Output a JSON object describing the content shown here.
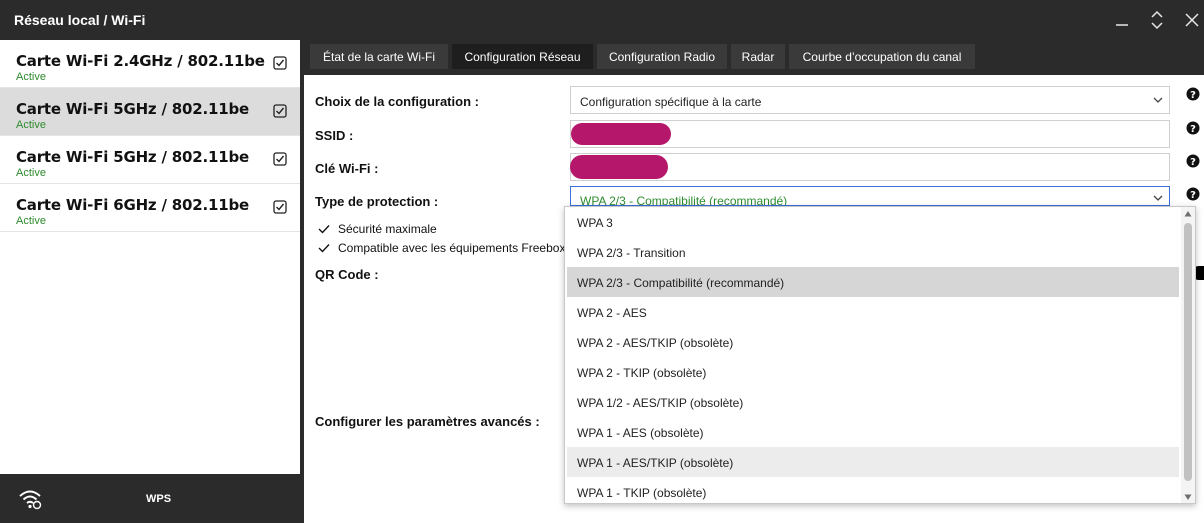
{
  "window": {
    "title": "Réseau local / Wi-Fi",
    "icons": [
      "minimize-icon",
      "restore-icon",
      "close-icon"
    ]
  },
  "sidebar": {
    "cards": [
      {
        "name": "Carte Wi-Fi 2.4GHz / 802.11be",
        "status": "Active"
      },
      {
        "name": "Carte Wi-Fi 5GHz / 802.11be",
        "status": "Active"
      },
      {
        "name": "Carte Wi-Fi 5GHz / 802.11be",
        "status": "Active"
      },
      {
        "name": "Carte Wi-Fi 6GHz / 802.11be",
        "status": "Active"
      }
    ],
    "bottom": {
      "wps_label": "WPS",
      "wifi_icon": "wifi-refresh-icon"
    }
  },
  "tabs": [
    {
      "label": "État de la carte Wi-Fi"
    },
    {
      "label": "Configuration Réseau"
    },
    {
      "label": "Configuration Radio"
    },
    {
      "label": "Radar"
    },
    {
      "label": "Courbe d’occupation du canal"
    }
  ],
  "form": {
    "config_label": "Choix de la configuration :",
    "config_value": "Configuration spécifique à la carte",
    "ssid_label": "SSID :",
    "key_label": "Clé Wi-Fi :",
    "protection_label": "Type de protection :",
    "protection_value": "WPA 2/3 - Compatibilité (recommandé)",
    "checks": [
      "Sécurité maximale",
      "Compatible avec les équipements Freebox"
    ],
    "qr_label": "QR Code :",
    "advanced_label": "Configurer les paramètres avancés :"
  },
  "dropdown": {
    "options": [
      "WPA 3",
      "WPA 2/3 - Transition",
      "WPA 2/3 - Compatibilité (recommandé)",
      "WPA 2 - AES",
      "WPA 2 - AES/TKIP (obsolète)",
      "WPA 2 - TKIP (obsolète)",
      "WPA 1/2 - AES/TKIP (obsolète)",
      "WPA 1 - AES (obsolète)",
      "WPA 1 - AES/TKIP (obsolète)",
      "WPA 1 - TKIP (obsolète)"
    ]
  },
  "colors": {
    "dark_bg": "#2b2b2b",
    "active_tab": "#1e1e1e",
    "status_green": "#2e8b2e",
    "redaction": "#b5176a"
  }
}
